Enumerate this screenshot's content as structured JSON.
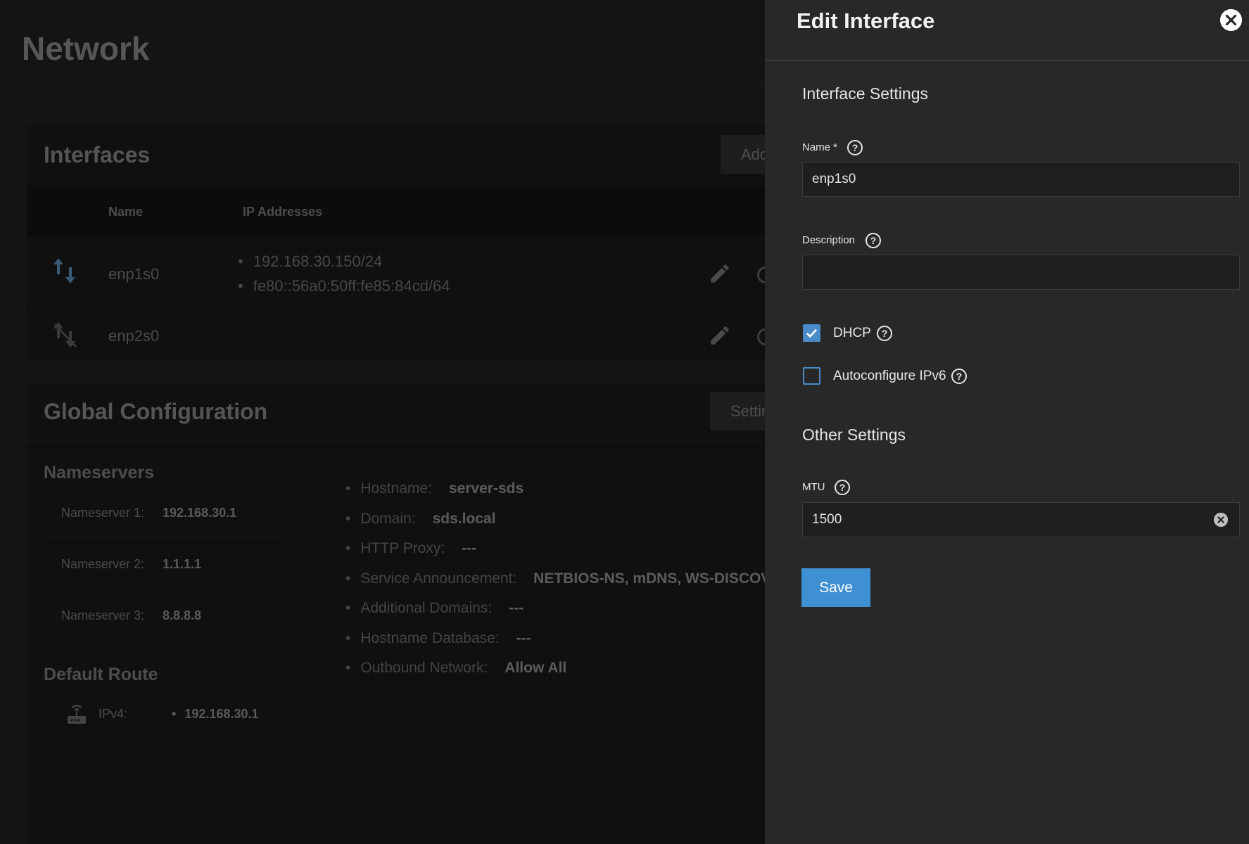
{
  "page": {
    "title": "Network"
  },
  "interfaces": {
    "title": "Interfaces",
    "add_button": "Add",
    "columns": {
      "name": "Name",
      "ip": "IP Addresses"
    },
    "rows": [
      {
        "name": "enp1s0",
        "icon": "link-up-arrows-icon",
        "ips": [
          "192.168.30.150/24",
          "fe80::56a0:50ff:fe85:84cd/64"
        ]
      },
      {
        "name": "enp2s0",
        "icon": "link-down-icon",
        "ips": []
      }
    ]
  },
  "global": {
    "title": "Global Configuration",
    "settings_button": "Settings",
    "nameservers_title": "Nameservers",
    "nameservers": [
      {
        "label": "Nameserver 1:",
        "value": "192.168.30.1"
      },
      {
        "label": "Nameserver 2:",
        "value": "1.1.1.1"
      },
      {
        "label": "Nameserver 3:",
        "value": "8.8.8.8"
      }
    ],
    "info": [
      {
        "label": "Hostname:",
        "value": "server-sds"
      },
      {
        "label": "Domain:",
        "value": "sds.local"
      },
      {
        "label": "HTTP Proxy:",
        "value": "---"
      },
      {
        "label": "Service Announcement:",
        "value": "NETBIOS-NS, mDNS, WS-DISCOVERY"
      },
      {
        "label": "Additional Domains:",
        "value": "---"
      },
      {
        "label": "Hostname Database:",
        "value": "---"
      },
      {
        "label": "Outbound Network:",
        "value": "Allow All"
      }
    ],
    "default_route_title": "Default Route",
    "route_label": "IPv4:",
    "route_value": "192.168.30.1"
  },
  "panel": {
    "title": "Edit Interface",
    "interface_settings": "Interface Settings",
    "name_label": "Name *",
    "name_value": "enp1s0",
    "description_label": "Description",
    "description_value": "",
    "dhcp_label": "DHCP",
    "dhcp_checked": true,
    "autoconfig_label": "Autoconfigure IPv6",
    "autoconfig_checked": false,
    "other_settings": "Other Settings",
    "mtu_label": "MTU",
    "mtu_value": "1500",
    "save_label": "Save",
    "accent_color": "#3f8fd3"
  }
}
